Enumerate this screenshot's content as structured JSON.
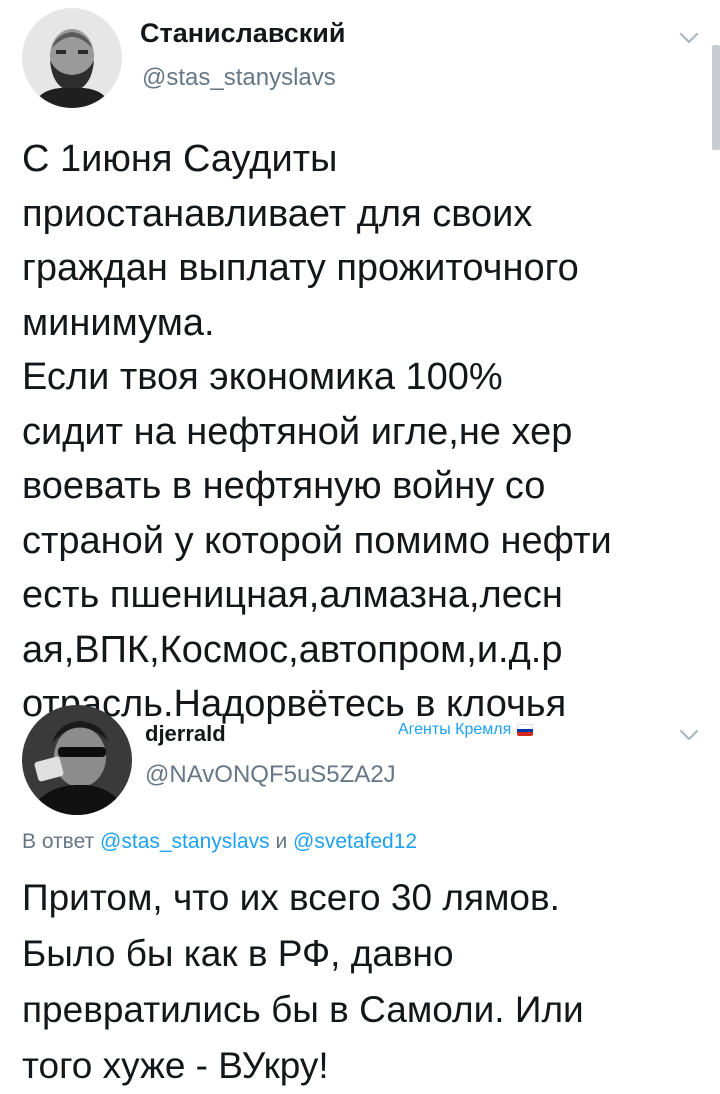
{
  "tweets": [
    {
      "author": {
        "display_name": "Станиславский",
        "handle": "@stas_stanyslavs",
        "avatar_icon": "avatar-photo-man-beard"
      },
      "text_lines": [
        "С 1июня Саудиты",
        "приостанавливает для своих",
        "граждан выплату прожиточного",
        "минимума.",
        "Если твоя экономика 100%",
        "сидит на нефтяной игле,не хер",
        "воевать в нефтяную войну со",
        "страной у которой помимо нефти",
        "есть пшеницная,алмазна,лесн",
        "ая,ВПК,Космос,автопром,и.д.р",
        "отрасль.Надорвётесь в клочья"
      ],
      "menu_icon": "chevron-down-icon"
    },
    {
      "author": {
        "display_name": "djerrald",
        "handle": "@NAvONQF5uS5ZA2J",
        "avatar_icon": "avatar-photo-man-glasses"
      },
      "badge": {
        "label": "Агенты Кремля",
        "flag_icon": "russian-flag-icon",
        "flag_colors": [
          "#ffffff",
          "#0039a6",
          "#d52b1e"
        ]
      },
      "reply": {
        "prefix": "В ответ",
        "mention_1": "@stas_stanyslavs",
        "conjunction": "и",
        "mention_2": "@svetafed12"
      },
      "text_lines": [
        "Притом, что их всего 30 лямов.",
        "Было бы как в РФ, давно",
        "превратились бы в Самоли. Или",
        "того хуже - ВУкру!"
      ],
      "menu_icon": "chevron-down-icon"
    }
  ],
  "colors": {
    "text": "#14171a",
    "secondary": "#657786",
    "link": "#1da1f2",
    "background": "#ffffff"
  }
}
